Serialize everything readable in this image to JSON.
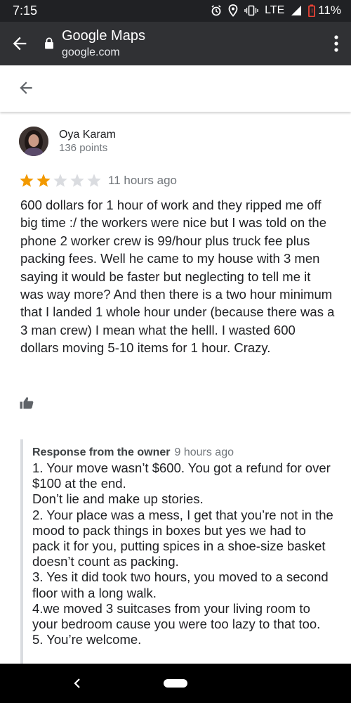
{
  "status_bar": {
    "time": "7:15",
    "network": "LTE",
    "battery": "11%"
  },
  "browser": {
    "title": "Google Maps",
    "url": "google.com"
  },
  "review": {
    "author": "Oya Karam",
    "points": "136 points",
    "rating": 2,
    "rating_max": 5,
    "time": "11 hours ago",
    "text": "600 dollars for 1 hour of work and they ripped me off big time :/ the workers were nice but I was told on the phone 2 worker crew is 99/hour plus truck fee plus packing fees. Well he came to my house with 3 men saying it would be faster but neglecting to tell me it was way more? And then there is a two hour minimum that I landed 1 whole hour under (because there was a 3 man crew) I mean what the helll. I wasted 600 dollars moving 5-10 items for 1 hour. Crazy."
  },
  "owner_response": {
    "label": "Response from the owner",
    "time": "9 hours ago",
    "text": "1. Your move wasn’t $600. You got a refund for over $100 at the end.\nDon’t lie and make up stories.\n2. Your place was a mess, I get that you’re not in the mood to pack things in boxes but yes we had to pack it for you, putting spices in a shoe-size basket doesn’t count as packing.\n3. Yes it did took two hours, you moved to a second floor with a long walk.\n4.we moved 3 suitcases from your living room to your bedroom cause you were too lazy to that too.\n5. You’re welcome."
  },
  "colors": {
    "star_filled": "#f29900",
    "star_empty": "#dadce0",
    "browser_bar": "#303134",
    "status_bar": "#202124",
    "battery_alert": "#ea4335"
  },
  "icons": [
    "arrow-back-icon",
    "lock-icon",
    "more-vert-icon",
    "thumbs-up-icon",
    "star-icon",
    "alarm-icon",
    "location-icon",
    "vibrate-icon",
    "signal-icon",
    "battery-icon",
    "nav-back-icon",
    "nav-home-icon"
  ]
}
